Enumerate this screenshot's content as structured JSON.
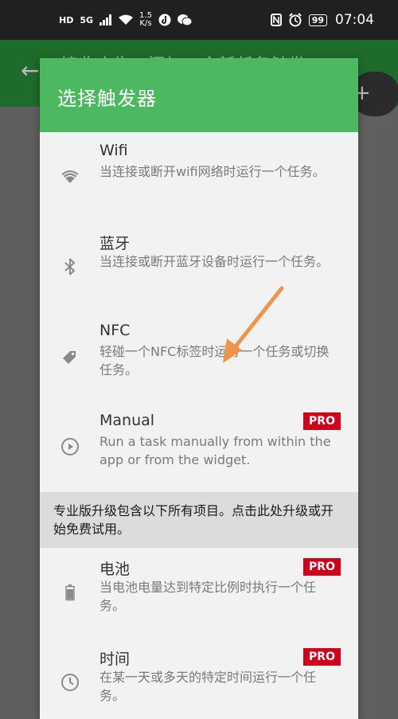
{
  "status_bar": {
    "hd": "HD",
    "network": "5G",
    "speed_value": "1.5",
    "speed_unit": "K/s",
    "battery": "99",
    "time": "07:04"
  },
  "background_app": {
    "title": "接收广告，添加一个新任务触发"
  },
  "dialog": {
    "title": "选择触发器",
    "pro_label": "PRO",
    "items_top": [
      {
        "title": "Wifi",
        "desc": "当连接或断开wifi网络时运行一个任务。",
        "icon": "wifi-icon",
        "pro": false
      },
      {
        "title": "蓝牙",
        "desc": "当连接或断开蓝牙设备时运行一个任务。",
        "icon": "bluetooth-icon",
        "pro": false
      },
      {
        "title": "NFC",
        "desc": "轻碰一个NFC标签时运行一个任务或切换任务。",
        "icon": "nfc-tag-icon",
        "pro": false
      },
      {
        "title": "Manual",
        "desc": "Run a task manually from within the app or from the widget.",
        "icon": "play-circle-icon",
        "pro": true
      }
    ],
    "promo_text": "专业版升级包含以下所有项目。点击此处升级或开始免费试用。",
    "items_bottom": [
      {
        "title": "电池",
        "desc": "当电池电量达到特定比例时执行一个任务。",
        "icon": "battery-icon",
        "pro": true
      },
      {
        "title": "时间",
        "desc": "在某一天或多天的特定时间运行一个任务。",
        "icon": "clock-icon",
        "pro": true
      }
    ]
  },
  "colors": {
    "header_green": "#4cb860",
    "pro_red": "#d0021b",
    "annotation_arrow": "#f0944a"
  }
}
